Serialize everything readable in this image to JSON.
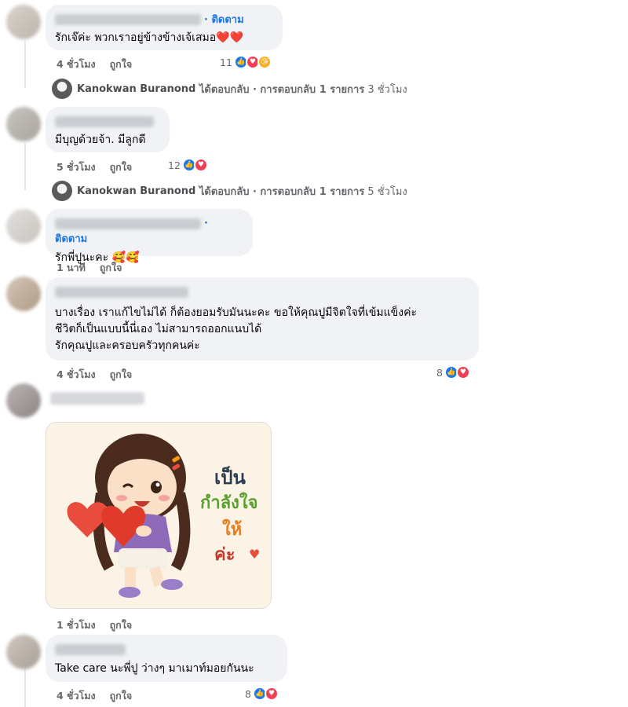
{
  "comments": [
    {
      "text": "รักเจ๊ค่ะ พวกเราอยู่ข้างข้างเจ้เสมอ❤️❤️",
      "follow": "· ติดตาม",
      "time": "4 ชั่วโมง",
      "like": "ถูกใจ",
      "reactions": "11"
    },
    {
      "text": "มีบุญด้วยจ้า. มีลูกดี",
      "time": "5 ชั่วโมง",
      "like": "ถูกใจ",
      "reactions": "12"
    },
    {
      "text": "รักพี่ปูนะคะ 🥰🥰",
      "follow": "· ติดตาม",
      "time": "1 นาที",
      "like": "ถูกใจ"
    },
    {
      "text": "บางเรื่อง เราแก้ไขไม่ได้ ก็ต้องยอมรับมันนะคะ ขอให้คุณปูมีจิตใจที่เข้มแข็งค่ะ\nชีวิตก็เป็นแบบนี้นี่เอง ไม่สามารถออกแนบได้\nรักคุณปูและครอบครัวทุกคนค่ะ",
      "time": "4 ชั่วโมง",
      "like": "ถูกใจ",
      "reactions": "8"
    },
    {
      "time": "1 ชั่วโมง",
      "like": "ถูกใจ",
      "sticker": {
        "line1": "เป็น",
        "line2": "กำลังใจ",
        "line3": "ให้",
        "line4": "ค่ะ"
      }
    },
    {
      "text": "Take care นะพี่ปู ว่างๆ มาเมาท์มอยกันนะ",
      "time": "4 ชั่วโมง",
      "like": "ถูกใจ",
      "reactions": "8"
    }
  ],
  "replies": [
    {
      "name": "Kanokwan Buranond",
      "action": "ได้ตอบกลับ · การตอบกลับ 1 รายการ",
      "time": "3 ชั่วโมง"
    },
    {
      "name": "Kanokwan Buranond",
      "action": "ได้ตอบกลับ · การตอบกลับ 1 รายการ",
      "time": "5 ชั่วโมง"
    }
  ],
  "colors": {
    "bubble": "#f0f2f5",
    "follow": "#1b74e4",
    "like": "#1877f2",
    "love": "#f33e58",
    "meta": "#65676b"
  }
}
